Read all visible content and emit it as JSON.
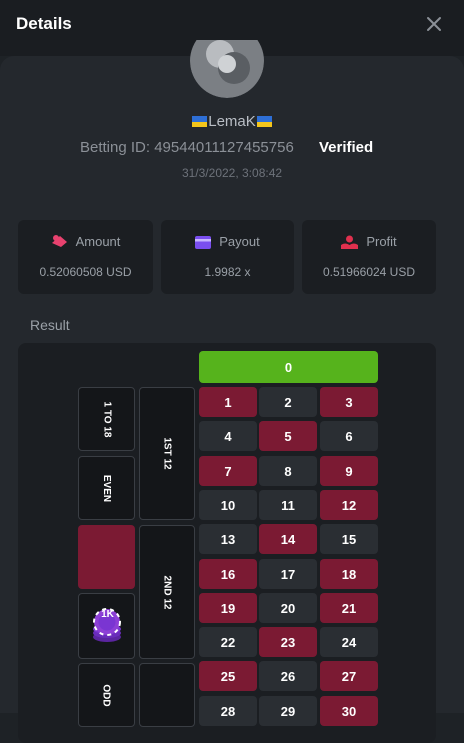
{
  "header": {
    "title": "Details"
  },
  "user": {
    "name": "LemaK",
    "betting_id": "Betting ID: 49544011127455756",
    "verified": "Verified",
    "date": "31/3/2022, 3:08:42"
  },
  "cards": [
    {
      "label": "Amount",
      "value": "0.52060508 USD",
      "icon": "amount-icon"
    },
    {
      "label": "Payout",
      "value": "1.9982 x",
      "icon": "payout-icon"
    },
    {
      "label": "Profit",
      "value": "0.51966024 USD",
      "icon": "profit-icon"
    }
  ],
  "result_label": "Result",
  "board": {
    "zero": "0",
    "numbers": [
      "1",
      "2",
      "3",
      "4",
      "5",
      "6",
      "7",
      "8",
      "9",
      "10",
      "11",
      "12",
      "13",
      "14",
      "15",
      "16",
      "17",
      "18",
      "19",
      "20",
      "21",
      "22",
      "23",
      "24",
      "25",
      "26",
      "27",
      "28",
      "29",
      "30"
    ],
    "red_numbers": [
      "1",
      "3",
      "5",
      "7",
      "9",
      "12",
      "14",
      "16",
      "18",
      "19",
      "21",
      "23",
      "25",
      "27",
      "30"
    ],
    "side_bets": [
      "1 TO 18",
      "EVEN",
      "ODD"
    ],
    "dozens": [
      "1ST 12",
      "2ND 12"
    ],
    "chip_label": "1K"
  },
  "colors": {
    "red": "#7b1a33",
    "black": "#2a2e33",
    "green": "#56b31c",
    "chip": "#8d3fd6"
  }
}
